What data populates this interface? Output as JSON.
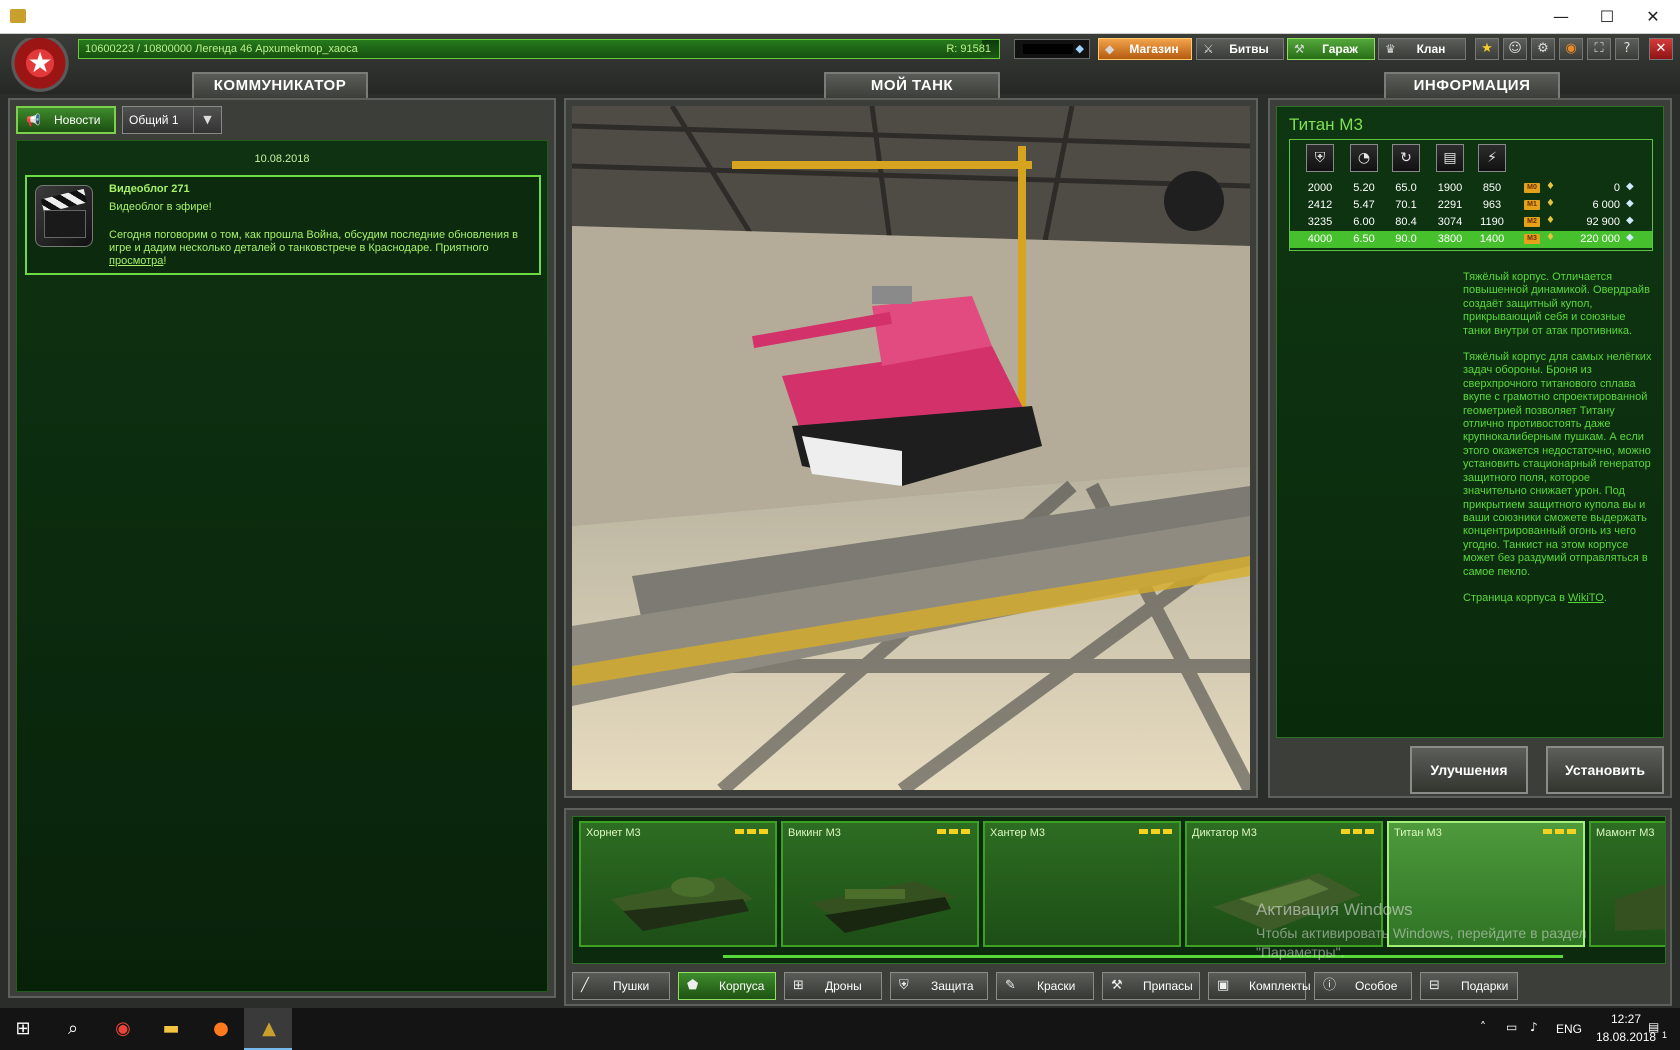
{
  "window": {
    "minimize": "—",
    "maximize": "☐",
    "close": "✕"
  },
  "topbar": {
    "xp_text": "10600223 / 10800000   Легенда 46 Архumekmop_хаоса",
    "xp_fraction": 0.981,
    "rating": "R: 91581",
    "buttons": {
      "shop": "Магазин",
      "battles": "Битвы",
      "garage": "Гараж",
      "clan": "Клан"
    }
  },
  "tabs": {
    "communicator": "КОММУНИКАТОР",
    "my_tank": "МОЙ ТАНК",
    "info": "ИНФОРМАЦИЯ"
  },
  "communicator": {
    "news_button": "Новости",
    "channel": "Общий 1",
    "date": "10.08.2018",
    "item": {
      "title": "Видеоблог 271",
      "subtitle": "Видеоблог в эфире!",
      "body": "Сегодня поговорим о том, как прошла Война, обсудим последние обновления в игре и дадим несколько деталей о танковстрече в Краснодаре. Приятного ",
      "link": "просмотра",
      "end": "!"
    }
  },
  "info": {
    "title": "Титан М3",
    "stat_icons": [
      "armor-icon",
      "speed-icon",
      "turn-icon",
      "weight-icon",
      "power-icon"
    ],
    "rows": [
      {
        "vals": [
          "2000",
          "5.20",
          "65.0",
          "1900",
          "850"
        ],
        "mod": "M0",
        "price": "0"
      },
      {
        "vals": [
          "2412",
          "5.47",
          "70.1",
          "2291",
          "963"
        ],
        "mod": "M1",
        "price": "6 000"
      },
      {
        "vals": [
          "3235",
          "6.00",
          "80.4",
          "3074",
          "1190"
        ],
        "mod": "M2",
        "price": "92 900"
      },
      {
        "vals": [
          "4000",
          "6.50",
          "90.0",
          "3800",
          "1400"
        ],
        "mod": "M3",
        "price": "220 000"
      }
    ],
    "desc_p1": "Тяжёлый корпус. Отличается повышенной динамикой. Овердрайв создаёт защитный купол, прикрывающий себя и союзные танки внутри от атак противника.",
    "desc_p2": "Тяжёлый корпус для самых нелёгких задач обороны. Броня из сверхпрочного титанового сплава вкупе с грамотно спроектированной геометрией позволяет Титану отлично противостоять даже крупнокалиберным пушкам. А если этого окажется недостаточно, можно установить стационарный генератор защитного поля, которое значительно снижает урон. Под прикрытием защитного купола вы и ваши союзники сможете выдержать концентрированный огонь из чего угодно. Танкист на этом корпусе может без раздумий отправляться в самое пекло.",
    "desc_link_prefix": "Страница корпуса в ",
    "desc_link": "WikiTO",
    "desc_link_suffix": ".",
    "btn_upgrades": "Улучшения",
    "btn_equip": "Установить"
  },
  "carousel": {
    "items": [
      "Хорнет М3",
      "Викинг М3",
      "Хантер М3",
      "Диктатор М3",
      "Титан М3",
      "Мамонт М3"
    ]
  },
  "categories": [
    "Пушки",
    "Корпуса",
    "Дроны",
    "Защита",
    "Краски",
    "Припасы",
    "Комплекты",
    "Особое",
    "Подарки"
  ],
  "watermark": {
    "title": "Активация Windows",
    "text": "Чтобы активировать Windows, перейдите в раздел \"Параметры\"."
  },
  "taskbar": {
    "lang": "ENG",
    "time": "12:27",
    "date": "18.08.2018",
    "notif": "1"
  },
  "colors": {
    "accent_green": "#59d83a",
    "shop_orange": "#e08a2a",
    "close_red": "#c42424"
  }
}
